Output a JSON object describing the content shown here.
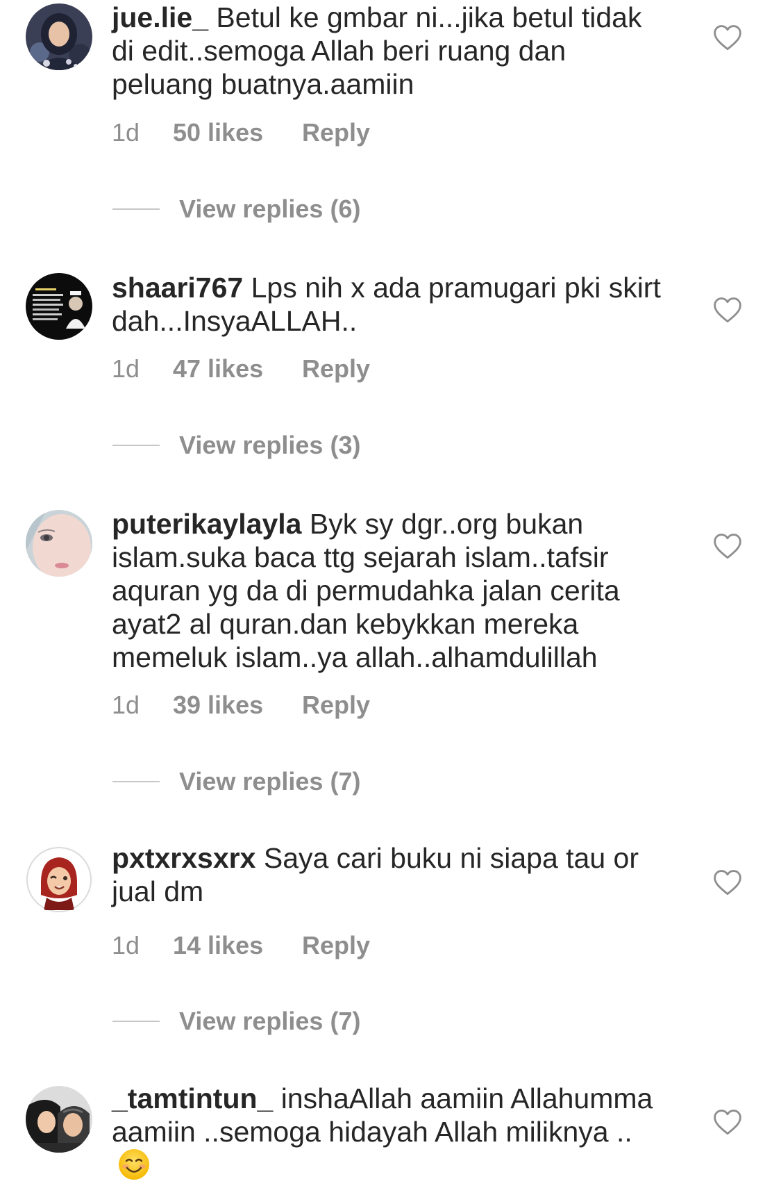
{
  "comments": [
    {
      "username": "jue.lie_",
      "text": "Betul ke gmbar ni...jika betul tidak di edit..semoga Allah beri ruang dan peluang buatnya.aamiin",
      "time": "1d",
      "likes": "50 likes",
      "reply": "Reply",
      "view_replies": "View replies (6)",
      "avatar": "profile-photo-woman-hijab"
    },
    {
      "username": "shaari767",
      "text": "Lps nih x ada pramugari pki skirt dah...InsyaALLAH..",
      "time": "1d",
      "likes": "47 likes",
      "reply": "Reply",
      "view_replies": "View replies (3)",
      "avatar": "profile-photo-quote-image"
    },
    {
      "username": "puterikaylayla",
      "text": "Byk sy dgr..org bukan islam.suka baca ttg sejarah islam..tafsir aquran yg da di permudahka  jalan cerita ayat2 al quran.dan kebykkan mereka memeluk islam..ya allah..alhamdulillah",
      "time": "1d",
      "likes": "39 likes",
      "reply": "Reply",
      "view_replies": "View replies (7)",
      "avatar": "profile-photo-face-closeup"
    },
    {
      "username": "pxtxrxsxrx",
      "text": "Saya cari buku ni siapa tau or jual dm",
      "time": "1d",
      "likes": "14 likes",
      "reply": "Reply",
      "view_replies": "View replies (7)",
      "avatar": "profile-memoji-hijab"
    },
    {
      "username": "_tamtintun_",
      "text": "inshaAllah aamiin Allahumma aamiin ..semoga hidayah Allah miliknya ..",
      "emoji": "smiling-face-emoji",
      "avatar": "profile-photo-two-women"
    }
  ],
  "icons": {
    "like": "heart-outline-icon"
  },
  "colors": {
    "text_primary": "#262626",
    "text_secondary": "#8e8e8e",
    "divider": "#c7c7c7",
    "background": "#ffffff"
  }
}
